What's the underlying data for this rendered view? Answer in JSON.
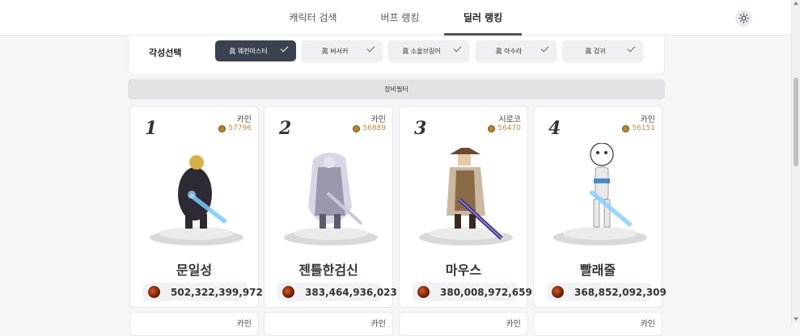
{
  "nav": {
    "tabs": [
      {
        "label": "캐릭터 검색"
      },
      {
        "label": "버프 랭킹"
      },
      {
        "label": "딜러 랭킹"
      }
    ],
    "active_tab": "딜러 랭킹",
    "theme_icon": "sun-icon"
  },
  "filter": {
    "label": "각성선택",
    "chips": [
      {
        "label": "眞 웨펀마스터",
        "selected": true
      },
      {
        "label": "眞 버서커",
        "selected": false
      },
      {
        "label": "眞 소울브링어",
        "selected": false
      },
      {
        "label": "眞 아수라",
        "selected": false
      },
      {
        "label": "眞 검귀",
        "selected": false
      }
    ]
  },
  "equip_filter": {
    "label": "장비필터"
  },
  "cards": [
    {
      "rank": "1",
      "server": "카인",
      "fame": "57796",
      "name": "문일성",
      "damage": "502,322,399,972"
    },
    {
      "rank": "2",
      "server": "카인",
      "fame": "56889",
      "name": "젠틀한검신",
      "damage": "383,464,936,023"
    },
    {
      "rank": "3",
      "server": "시로코",
      "fame": "56470",
      "name": "마우스",
      "damage": "380,008,972,659"
    },
    {
      "rank": "4",
      "server": "카인",
      "fame": "56151",
      "name": "빨래줄",
      "damage": "368,852,092,309"
    }
  ],
  "next_row": [
    {
      "server": "카인"
    },
    {
      "server": "카인"
    },
    {
      "server": "카인"
    },
    {
      "server": "카인"
    }
  ],
  "colors": {
    "accent": "#3a4150",
    "fame": "#c08a3a"
  }
}
